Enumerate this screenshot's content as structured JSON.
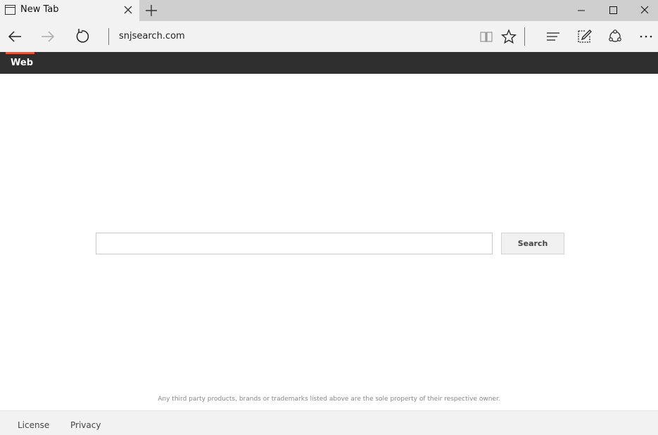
{
  "browser": {
    "tab": {
      "title": "New Tab",
      "icon": "page-icon"
    },
    "address": "snjsearch.com",
    "window_controls": [
      "minimize-icon",
      "maximize-icon",
      "close-icon"
    ],
    "toolbar_icons": [
      "back-icon",
      "forward-icon",
      "refresh-icon",
      "reading-view-icon",
      "favorite-star-icon",
      "hub-icon",
      "web-note-icon",
      "share-icon",
      "more-icon"
    ]
  },
  "site": {
    "nav": {
      "active_tab": "Web",
      "accent_color": "#e05a41",
      "bar_color": "#2f2f2f"
    },
    "search": {
      "value": "",
      "placeholder": "",
      "button_label": "Search"
    },
    "disclaimer": "Any third party products, brands or trademarks listed above are the sole property of their respective owner.",
    "footer": {
      "links": [
        "License",
        "Privacy"
      ]
    }
  }
}
